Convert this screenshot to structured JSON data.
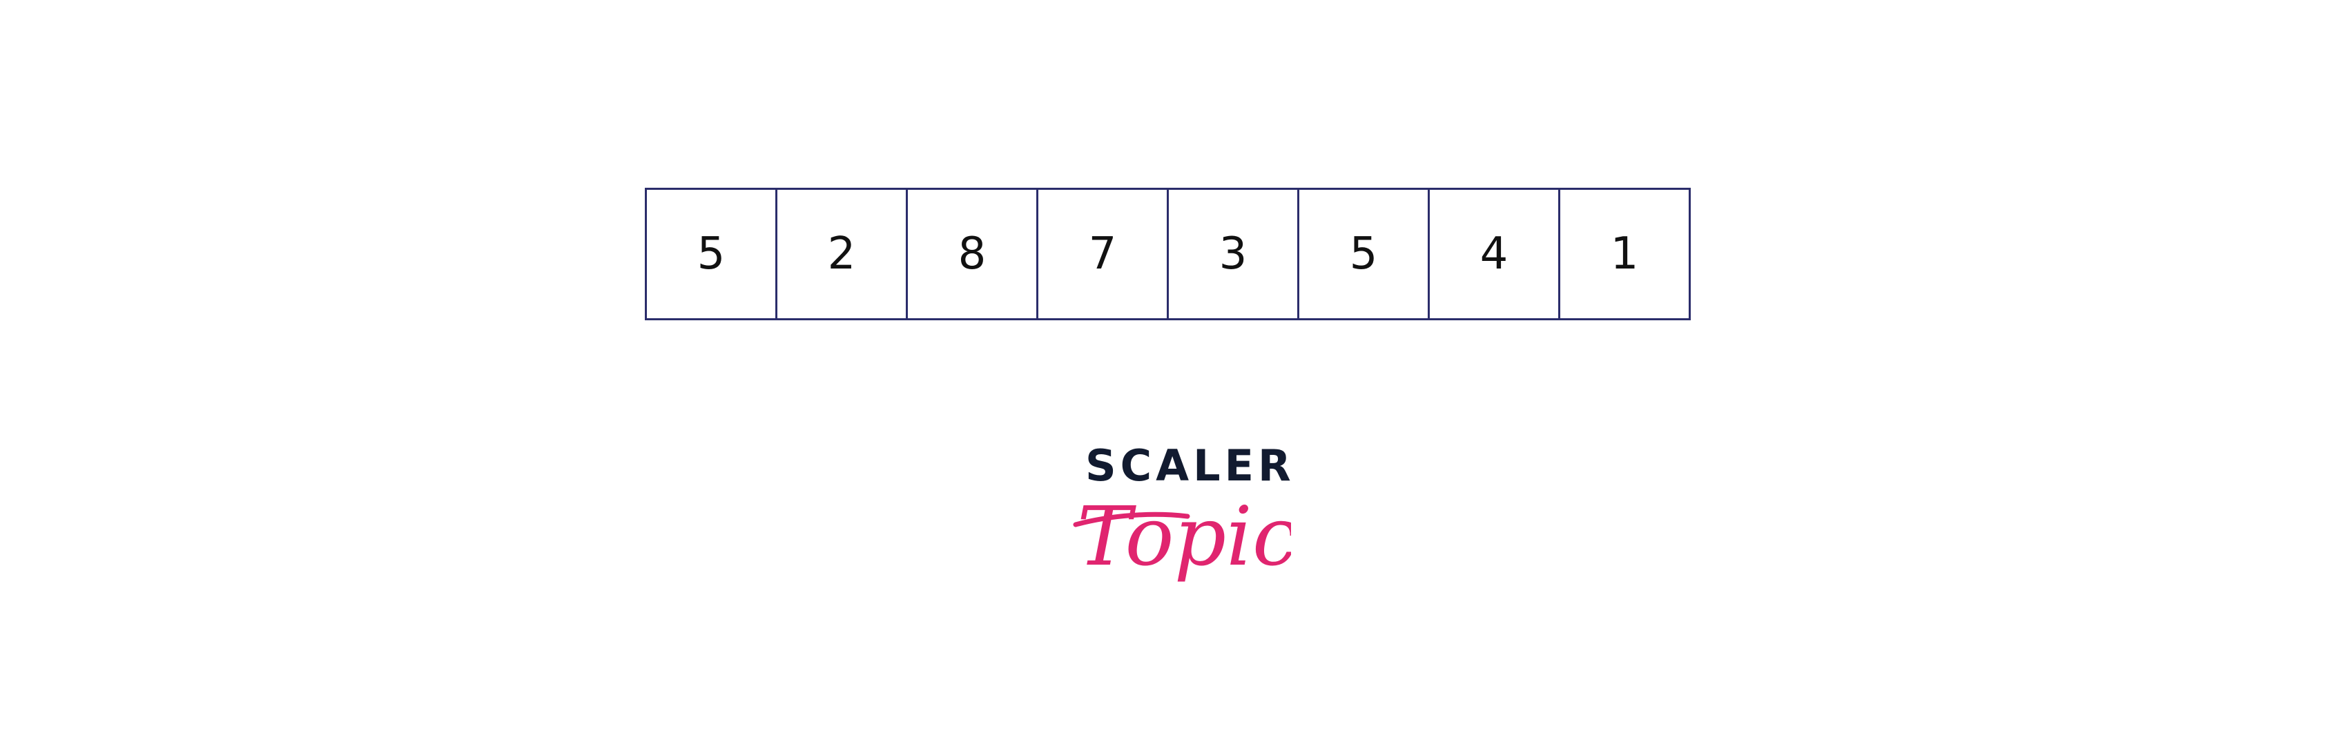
{
  "array": {
    "values": [
      "5",
      "2",
      "8",
      "7",
      "3",
      "5",
      "4",
      "1"
    ]
  },
  "logo": {
    "top_text": "SCALER",
    "script_text": "Topics",
    "top_color": "#121b30",
    "script_color": "#e0256f"
  },
  "colors": {
    "cell_border": "#2b2d6b",
    "background": "#ffffff"
  }
}
